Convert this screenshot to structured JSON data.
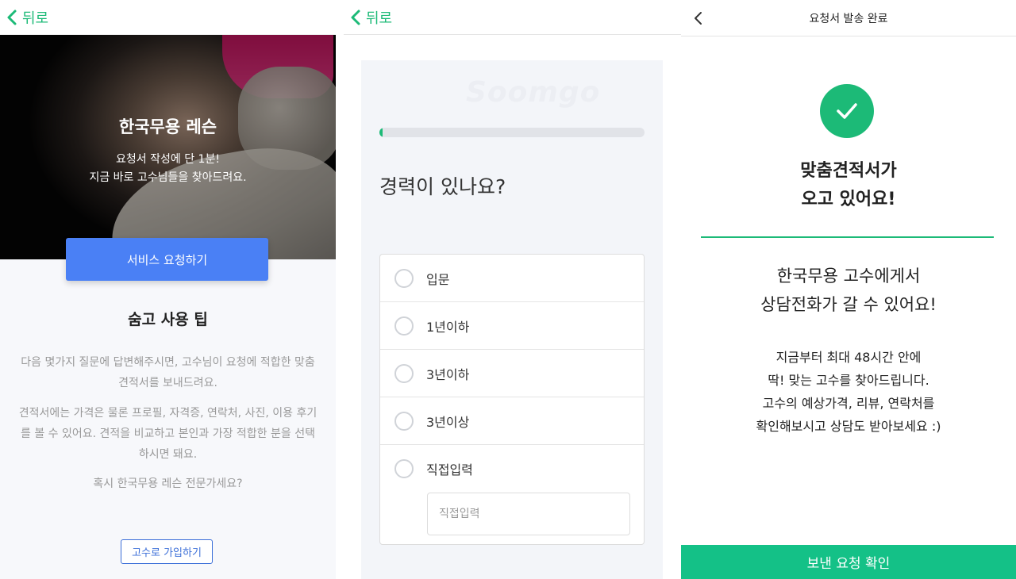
{
  "panel1": {
    "back_label": "뒤로",
    "hero": {
      "title": "한국무용 레슨",
      "subtitle_line1": "요청서 작성에 단 1분!",
      "subtitle_line2": "지금 바로 고수님들을 찾아드려요."
    },
    "request_button": "서비스 요청하기",
    "tips_title": "숨고 사용 팁",
    "tip1": "다음 몇가지 질문에 답변해주시면, 고수님이 요청에 적합한 맞춤 견적서를 보내드려요.",
    "tip2": "견적서에는 가격은 물론 프로필, 자격증, 연락처, 사진, 이용 후기를 볼 수 있어요. 견적을 비교하고 본인과 가장 적합한 분을 선택하시면 돼요.",
    "tip3": "혹시 한국무용 레슨 전문가세요?",
    "signup_button": "고수로 가입하기"
  },
  "panel2": {
    "back_label": "뒤로",
    "watermark": "Soomgo",
    "progress": 0.01,
    "question": "경력이 있나요?",
    "options": [
      "입문",
      "1년이하",
      "3년이하",
      "3년이상"
    ],
    "direct_option": "직접입력",
    "direct_placeholder": "직접입력"
  },
  "panel3": {
    "title": "요청서 발송 완료",
    "headline_line1": "맞춤견적서가",
    "headline_line2": "오고 있어요!",
    "sub_line1": "한국무용 고수에게서",
    "sub_line2": "상담전화가 갈 수 있어요!",
    "body_line1": "지금부터 최대 48시간 안에",
    "body_line2": "딱! 맞는 고수를 찾아드립니다.",
    "body_line3": "고수의 예상가격, 리뷰, 연락처를",
    "body_line4": "확인해보시고 상담도 받아보세요 :)",
    "confirm_button": "보낸 요청 확인"
  },
  "colors": {
    "brand_green": "#1cba77",
    "primary_blue": "#4a80f5",
    "confirm_green": "#14c187"
  },
  "icons": {
    "back": "chevron-left-icon",
    "check": "check-icon"
  }
}
